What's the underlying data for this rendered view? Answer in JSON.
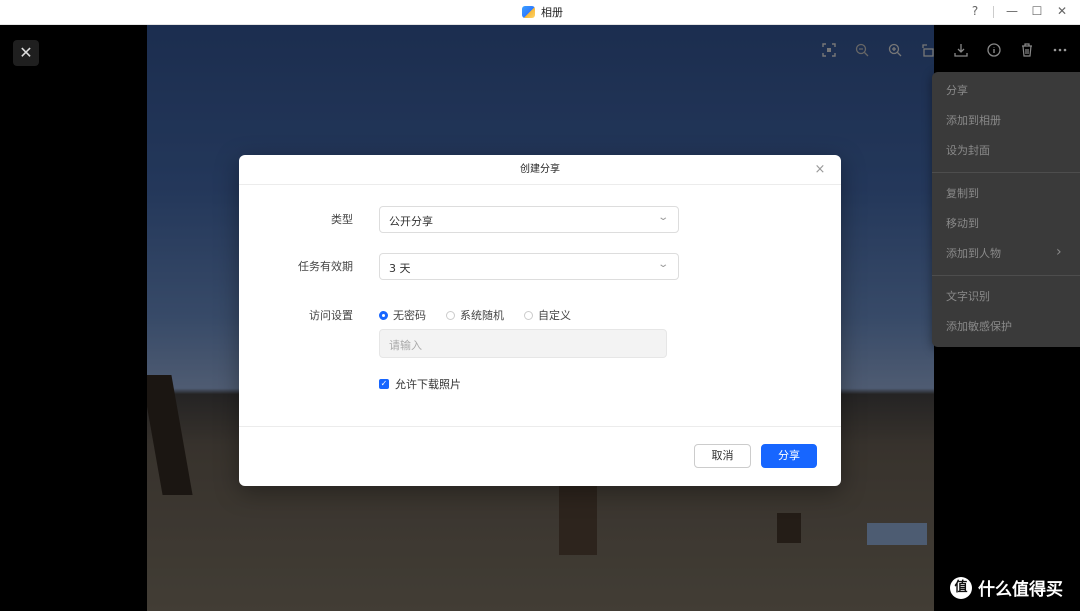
{
  "window": {
    "title": "相册",
    "controls": {
      "help": "?",
      "minimize": "—",
      "maximize": "☐",
      "close": "✕"
    }
  },
  "viewer": {
    "close_label": "✕",
    "toolbar_icons": [
      "scan-icon",
      "zoom-out-icon",
      "zoom-in-icon",
      "rotate-icon",
      "download-icon",
      "info-icon",
      "delete-icon",
      "more-icon"
    ]
  },
  "context_menu": {
    "items": [
      {
        "label": "分享"
      },
      {
        "label": "添加到相册"
      },
      {
        "label": "设为封面"
      },
      {
        "label": "复制到"
      },
      {
        "label": "移动到"
      },
      {
        "label": "添加到人物",
        "submenu": true
      },
      {
        "label": "文字识别"
      },
      {
        "label": "添加敏感保护"
      }
    ],
    "submenu_arrow": "›"
  },
  "dialog": {
    "title": "创建分享",
    "close": "×",
    "type_label": "类型",
    "type_value": "公开分享",
    "validity_label": "任务有效期",
    "validity_value": "3 天",
    "access_label": "访问设置",
    "access_options": [
      {
        "label": "无密码",
        "selected": true
      },
      {
        "label": "系统随机",
        "selected": false
      },
      {
        "label": "自定义",
        "selected": false
      }
    ],
    "password_placeholder": "请输入",
    "allow_download_label": "允许下载照片",
    "allow_download_checked": true,
    "cancel_label": "取消",
    "share_label": "分享",
    "chevron": "⌄"
  },
  "watermark": {
    "logo": "值",
    "text": "什么值得买"
  },
  "colors": {
    "accent": "#1766ff",
    "menu_bg": "#3a3a3a"
  }
}
